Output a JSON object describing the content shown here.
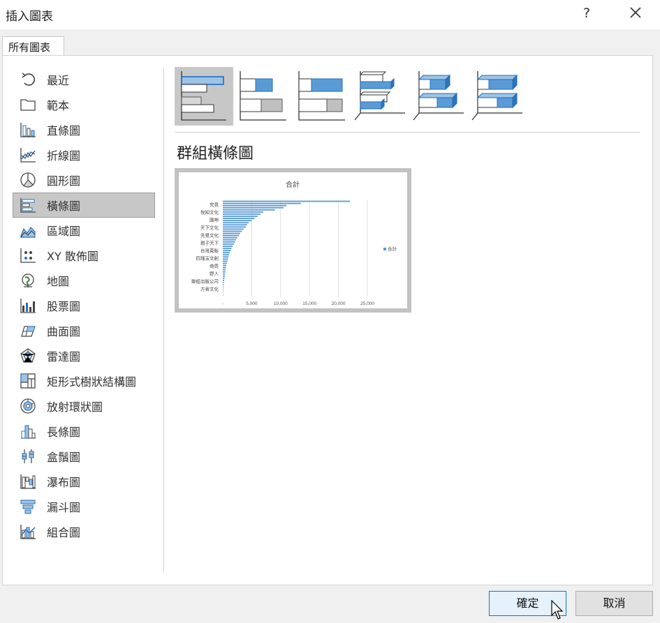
{
  "window": {
    "title": "插入圖表",
    "help_label": "?"
  },
  "tabs": [
    {
      "label": "所有圖表"
    }
  ],
  "sidebar": {
    "items": [
      {
        "label": "最近",
        "icon": "recent-icon"
      },
      {
        "label": "範本",
        "icon": "template-folder-icon"
      },
      {
        "label": "直條圖",
        "icon": "column-chart-icon"
      },
      {
        "label": "折線圖",
        "icon": "line-chart-icon"
      },
      {
        "label": "圓形圖",
        "icon": "pie-chart-icon"
      },
      {
        "label": "橫條圖",
        "icon": "bar-chart-icon",
        "selected": true
      },
      {
        "label": "區域圖",
        "icon": "area-chart-icon"
      },
      {
        "label": "XY 散佈圖",
        "icon": "scatter-chart-icon"
      },
      {
        "label": "地圖",
        "icon": "map-globe-icon"
      },
      {
        "label": "股票圖",
        "icon": "stock-chart-icon"
      },
      {
        "label": "曲面圖",
        "icon": "surface-chart-icon"
      },
      {
        "label": "雷達圖",
        "icon": "radar-chart-icon"
      },
      {
        "label": "矩形式樹狀結構圖",
        "icon": "treemap-icon"
      },
      {
        "label": "放射環狀圖",
        "icon": "sunburst-icon"
      },
      {
        "label": "長條圖",
        "icon": "histogram-icon"
      },
      {
        "label": "盒鬚圖",
        "icon": "box-whisker-icon"
      },
      {
        "label": "瀑布圖",
        "icon": "waterfall-icon"
      },
      {
        "label": "漏斗圖",
        "icon": "funnel-icon"
      },
      {
        "label": "組合圖",
        "icon": "combo-chart-icon"
      }
    ]
  },
  "subtypes": [
    {
      "icon": "clustered-bar-icon",
      "selected": true
    },
    {
      "icon": "stacked-bar-icon"
    },
    {
      "icon": "stacked-bar-100-icon"
    },
    {
      "icon": "clustered-bar-3d-icon"
    },
    {
      "icon": "stacked-bar-3d-icon"
    },
    {
      "icon": "stacked-bar-100-3d-icon"
    }
  ],
  "selected_subtype_title": "群組橫條圖",
  "colors": {
    "accent": "#0078d7",
    "selection": "#c7c7c7",
    "bar_fill": "#5b9bd5",
    "bar_light": "#9dc3e6"
  },
  "chart_data": {
    "type": "bar",
    "title": "合計",
    "categories": [
      "究竟",
      "悅知文化",
      "圓神",
      "天下文化",
      "先覺文化",
      "親子天下",
      "台灣東販",
      "四塊玉文創",
      "商周",
      "野人",
      "聯經出版公司",
      "方舍文化"
    ],
    "series": [
      {
        "name": "合計"
      }
    ],
    "x_ticks": [
      "-",
      "5,000",
      "10,000",
      "15,000",
      "20,000",
      "25,000"
    ],
    "xlim": [
      0,
      25000
    ],
    "approx_bar_values": [
      22000,
      13500,
      11000,
      10500,
      9000,
      7000,
      6500,
      6000,
      5500,
      5000,
      4500,
      4200,
      4000,
      3600,
      3300,
      3000,
      2800,
      2500,
      2300,
      2100,
      1900,
      1700,
      1500,
      1400,
      1200,
      1100,
      1000,
      900,
      800,
      700,
      600,
      550,
      500,
      450,
      400,
      350,
      300,
      250,
      200,
      150,
      120,
      100,
      80,
      60,
      40
    ],
    "legend_position": "right",
    "grid": true
  },
  "buttons": {
    "ok": "確定",
    "cancel": "取消"
  }
}
